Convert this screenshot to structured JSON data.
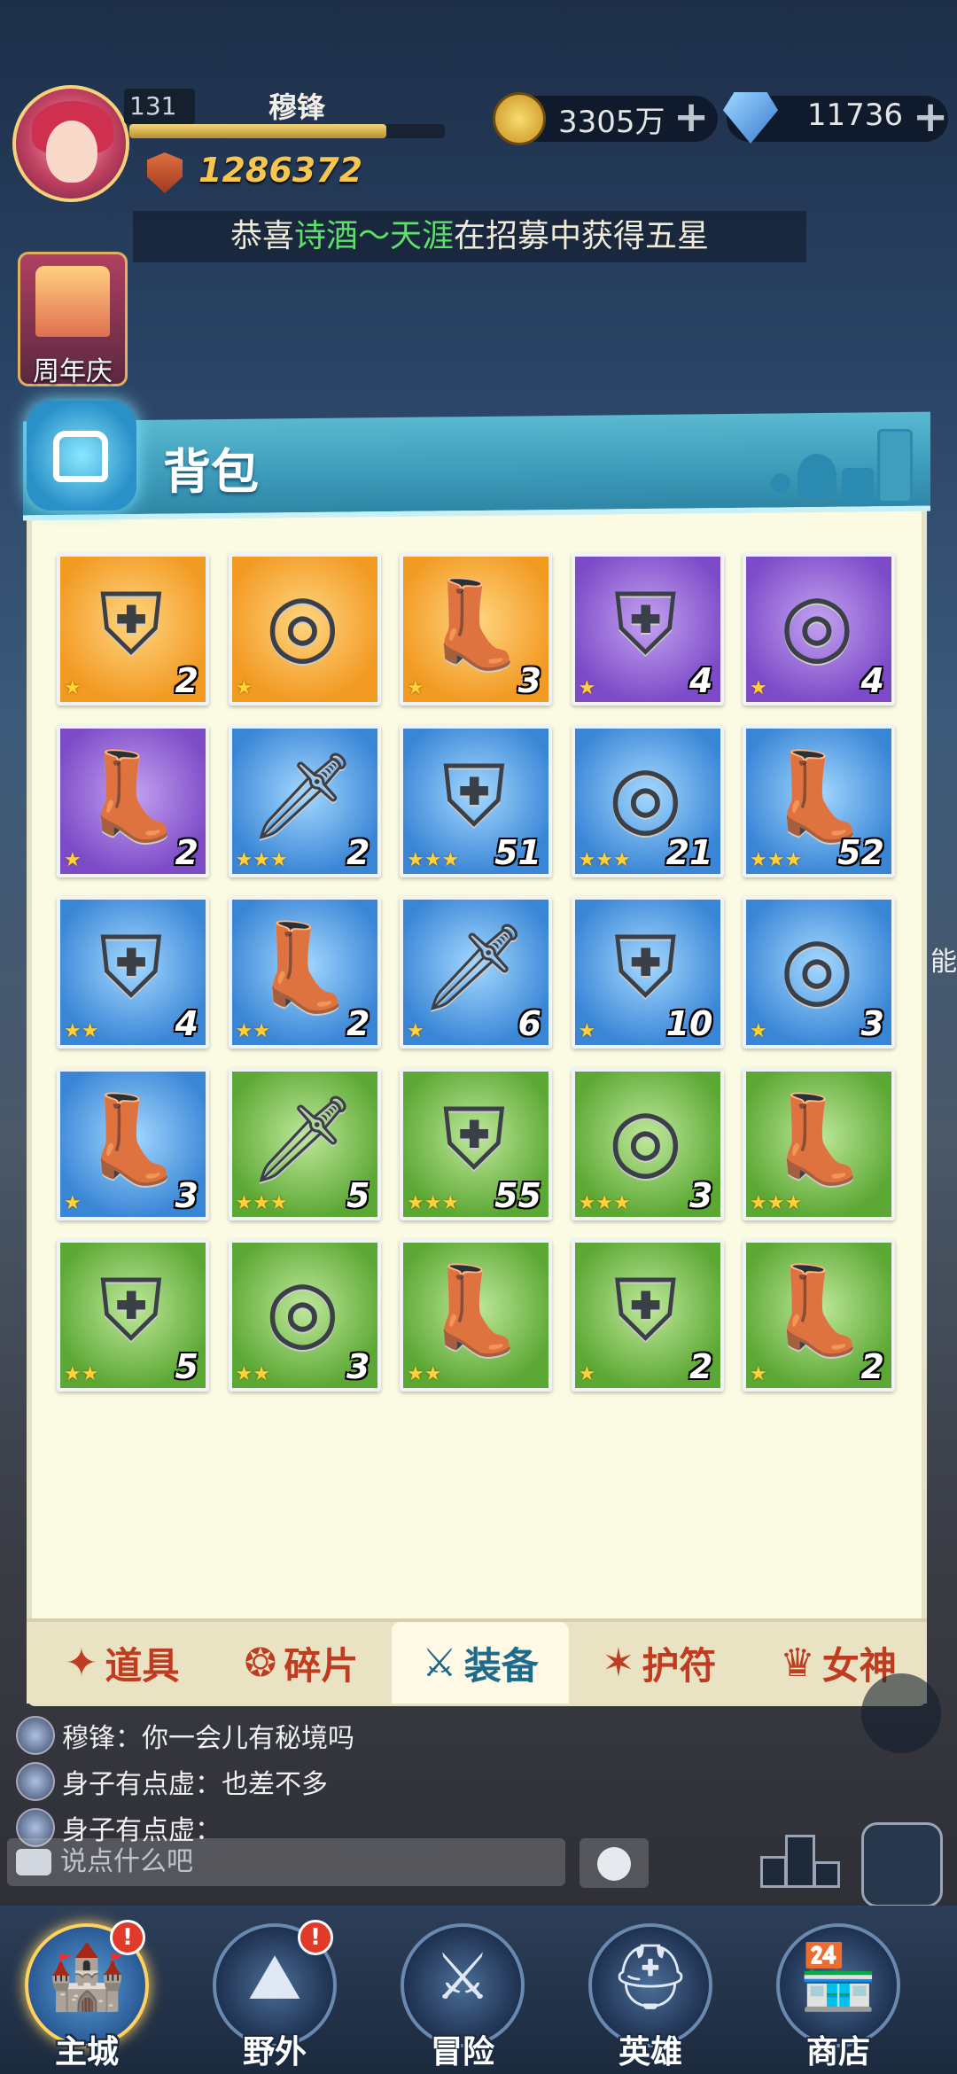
{
  "player": {
    "level": "131",
    "name": "穆锋",
    "xp_fraction": 0.82,
    "power": "1286372"
  },
  "resources": {
    "gold": "3305万",
    "gems": "11736",
    "plus": "+"
  },
  "marquee": {
    "prefix": "恭喜",
    "player": "诗酒～天涯",
    "suffix": "在招募中获得五星"
  },
  "events": {
    "anniversary": "周年庆"
  },
  "side_text": "能",
  "bag": {
    "title": "背包",
    "items": [
      {
        "name": "chestplate",
        "quality": "orange",
        "stars": 1,
        "count": "2",
        "glyph": "⛨"
      },
      {
        "name": "ring",
        "quality": "orange",
        "stars": 1,
        "count": "",
        "glyph": "◎"
      },
      {
        "name": "boots",
        "quality": "orange",
        "stars": 1,
        "count": "3",
        "glyph": "👢"
      },
      {
        "name": "chestplate",
        "quality": "purple",
        "stars": 1,
        "count": "4",
        "glyph": "⛨"
      },
      {
        "name": "ring",
        "quality": "purple",
        "stars": 1,
        "count": "4",
        "glyph": "◎"
      },
      {
        "name": "boots",
        "quality": "purple",
        "stars": 1,
        "count": "2",
        "glyph": "👢"
      },
      {
        "name": "sword",
        "quality": "blue",
        "stars": 3,
        "count": "2",
        "glyph": "🗡"
      },
      {
        "name": "chestplate",
        "quality": "blue",
        "stars": 3,
        "count": "51",
        "glyph": "⛨"
      },
      {
        "name": "ring",
        "quality": "blue",
        "stars": 3,
        "count": "21",
        "glyph": "◎"
      },
      {
        "name": "boots",
        "quality": "blue",
        "stars": 3,
        "count": "52",
        "glyph": "👢"
      },
      {
        "name": "chestplate",
        "quality": "blue",
        "stars": 2,
        "count": "4",
        "glyph": "⛨"
      },
      {
        "name": "boots",
        "quality": "blue",
        "stars": 2,
        "count": "2",
        "glyph": "👢"
      },
      {
        "name": "sword",
        "quality": "blue",
        "stars": 1,
        "count": "6",
        "glyph": "🗡"
      },
      {
        "name": "chestplate",
        "quality": "blue",
        "stars": 1,
        "count": "10",
        "glyph": "⛨"
      },
      {
        "name": "ring",
        "quality": "blue",
        "stars": 1,
        "count": "3",
        "glyph": "◎"
      },
      {
        "name": "boots",
        "quality": "blue",
        "stars": 1,
        "count": "3",
        "glyph": "👢"
      },
      {
        "name": "sword",
        "quality": "green",
        "stars": 3,
        "count": "5",
        "glyph": "🗡"
      },
      {
        "name": "chestplate",
        "quality": "green",
        "stars": 3,
        "count": "55",
        "glyph": "⛨"
      },
      {
        "name": "ring",
        "quality": "green",
        "stars": 3,
        "count": "3",
        "glyph": "◎"
      },
      {
        "name": "boots",
        "quality": "green",
        "stars": 3,
        "count": "",
        "glyph": "👢"
      },
      {
        "name": "chestplate",
        "quality": "green",
        "stars": 2,
        "count": "5",
        "glyph": "⛨"
      },
      {
        "name": "ring",
        "quality": "green",
        "stars": 2,
        "count": "3",
        "glyph": "◎"
      },
      {
        "name": "boots",
        "quality": "green",
        "stars": 2,
        "count": "",
        "glyph": "👢"
      },
      {
        "name": "chestplate",
        "quality": "green",
        "stars": 1,
        "count": "2",
        "glyph": "⛨"
      },
      {
        "name": "boots",
        "quality": "green",
        "stars": 1,
        "count": "2",
        "glyph": "👢"
      }
    ],
    "tabs": [
      {
        "label": "道具",
        "icon": "✦",
        "active": false
      },
      {
        "label": "碎片",
        "icon": "❂",
        "active": false
      },
      {
        "label": "装备",
        "icon": "⚔",
        "active": true
      },
      {
        "label": "护符",
        "icon": "✶",
        "active": false
      },
      {
        "label": "女神",
        "icon": "♛",
        "active": false
      }
    ]
  },
  "chat": {
    "messages": [
      {
        "text": "穆锋：你一会儿有秘境吗"
      },
      {
        "text": "身子有点虚：也差不多"
      },
      {
        "text": "身子有点虚："
      }
    ],
    "placeholder": "说点什么吧"
  },
  "nav": {
    "items": [
      {
        "label": "主城",
        "glyph": "🏰",
        "badge": "!",
        "active": true
      },
      {
        "label": "野外",
        "glyph": "⛰",
        "badge": "!",
        "active": false
      },
      {
        "label": "冒险",
        "glyph": "⚔",
        "badge": "",
        "active": false
      },
      {
        "label": "英雄",
        "glyph": "⛑",
        "badge": "",
        "active": false
      },
      {
        "label": "商店",
        "glyph": "🏪",
        "badge": "",
        "active": false
      }
    ]
  },
  "colors": {
    "gold": "#f6c64e",
    "header": "#3e9ebc",
    "panel": "#fbfbe3",
    "tab_text": "#c03c20",
    "tab_active": "#1d6a8a",
    "quality_orange": "#f29a22",
    "quality_purple": "#7d4bc8",
    "quality_blue": "#3a86d6",
    "quality_green": "#5ca834"
  }
}
